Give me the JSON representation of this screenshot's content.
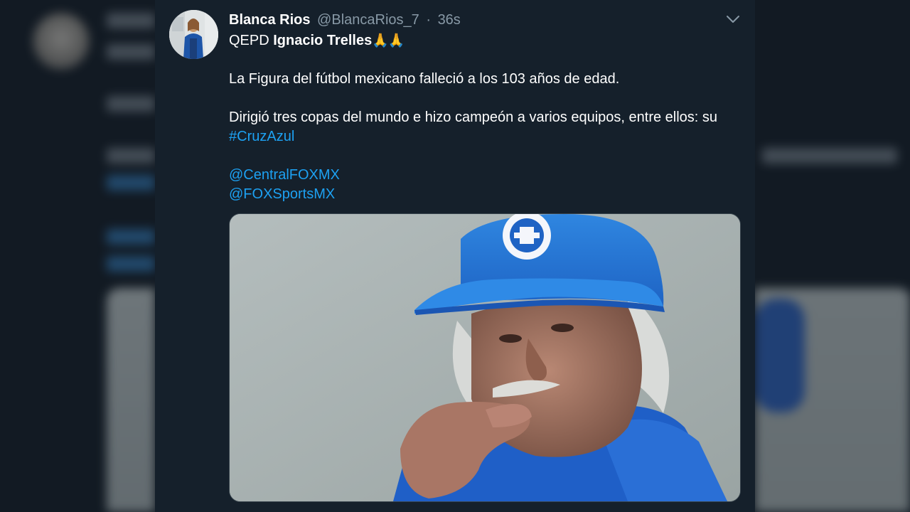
{
  "tweet": {
    "author_name": "Blanca Rios",
    "author_handle": "@BlancaRios_7",
    "separator": "·",
    "timestamp": "36s",
    "line1_prefix": "QEPD ",
    "line1_bold": "Ignacio Trelles",
    "line1_emoji": "🙏🙏",
    "line2": "La Figura del fútbol mexicano falleció a los 103 años de edad.",
    "line3": "Dirigió tres copas del mundo e hizo campeón a varios equipos, entre ellos: su",
    "hashtag": "#CruzAzul",
    "mention1": "@CentralFOXMX",
    "mention2": "@FOXSportsMX"
  },
  "icons": {
    "menu": "chevron-down-icon"
  },
  "colors": {
    "background": "#15202b",
    "text": "#ffffff",
    "secondary_text": "#8899a6",
    "link": "#1da1f2",
    "border": "#38444d"
  }
}
